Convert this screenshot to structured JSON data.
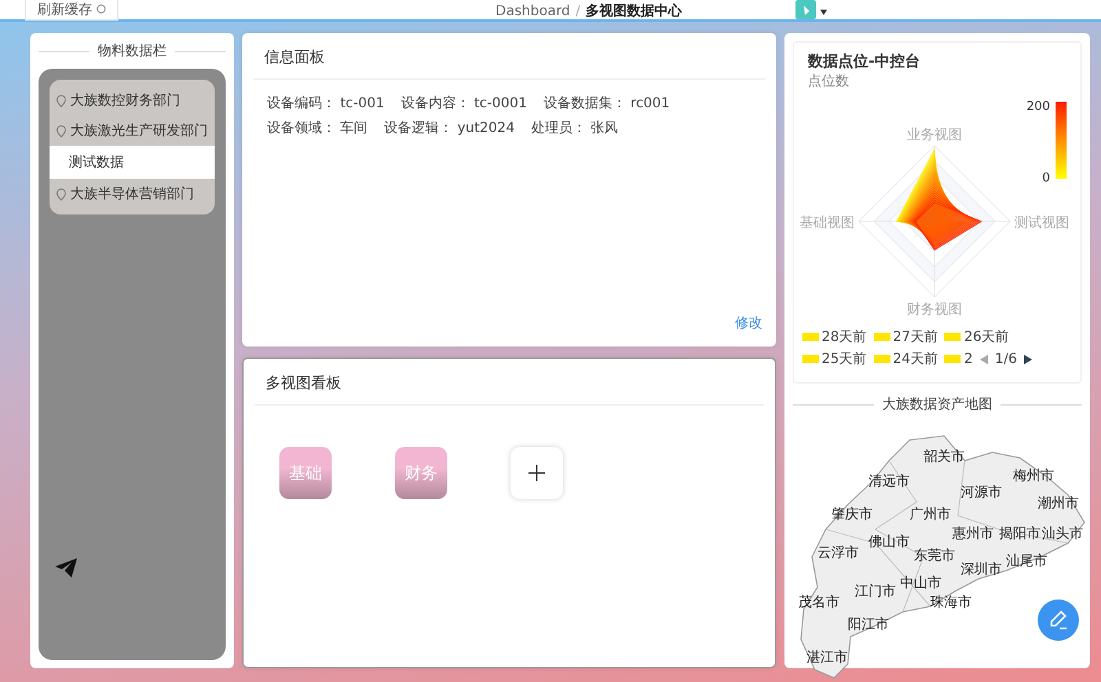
{
  "toolbar": {
    "refresh_button": "刷新缓存"
  },
  "breadcrumb_separator": "/",
  "breadcrumb": [
    {
      "label": "Dashboard",
      "selected": false
    },
    {
      "label": "多视图数据中心",
      "selected": true
    }
  ],
  "sidebar": {
    "title": "物料数据栏",
    "items": [
      {
        "label": "大族数控财务部门",
        "selected": false
      },
      {
        "label": "大族激光生产研发部门",
        "selected": false
      },
      {
        "label": "测试数据",
        "selected": true
      },
      {
        "label": "大族半导体营销部门",
        "selected": false
      }
    ]
  },
  "info_panel": {
    "title": "信息面板",
    "fields": [
      {
        "label": "设备编码：",
        "value": "tc-001"
      },
      {
        "label": "设备内容：",
        "value": "tc-0001"
      },
      {
        "label": "设备数据集：",
        "value": "rc001"
      },
      {
        "label": "设备领域：",
        "value": "车间"
      },
      {
        "label": "设备逻辑：",
        "value": "yut2024"
      },
      {
        "label": "处理员：",
        "value": "张风"
      }
    ],
    "edit_link": "修改"
  },
  "board": {
    "title": "多视图看板",
    "tiles": [
      {
        "kind": "view",
        "label": "基础"
      },
      {
        "kind": "view",
        "label": "财务"
      },
      {
        "kind": "add"
      }
    ]
  },
  "radar": {
    "title": "数据点位-中控台",
    "subtitle": "点位数",
    "axes": [
      "业务视图",
      "测试视图",
      "财务视图",
      "基础视图"
    ],
    "scale_max": "200",
    "scale_min": "0",
    "legend": [
      "28天前",
      "27天前",
      "26天前",
      "25天前",
      "24天前",
      "2"
    ],
    "page": "1/6"
  },
  "map": {
    "title": "大族数据资产地图",
    "cities": [
      "韶关市",
      "清远市",
      "河源市",
      "梅州市",
      "潮州市",
      "肇庆市",
      "广州市",
      "惠州市",
      "揭阳市",
      "汕头市",
      "佛山市",
      "东莞市",
      "汕尾市",
      "云浮市",
      "深圳市",
      "中山市",
      "江门市",
      "珠海市",
      "茂名市",
      "阳江市",
      "湛江市"
    ]
  }
}
